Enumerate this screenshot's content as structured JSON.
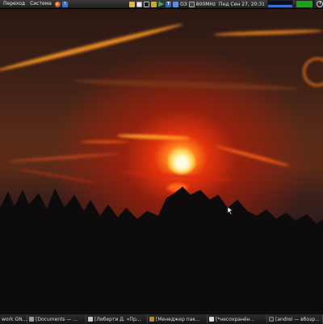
{
  "top_panel": {
    "menus": [
      "Переход",
      "Система"
    ],
    "cpu_frequency": "800MHz",
    "clock": "Пнд Сен 27, 20:31",
    "tray_label": "ОЗ",
    "icons": [
      "firefox-icon",
      "help-icon",
      "folder-icon",
      "notes-icon",
      "monitor-icon",
      "book-icon",
      "media-play-icon",
      "translator-icon",
      "box-icon",
      "chip-icon",
      "power-icon"
    ]
  },
  "taskbar": {
    "tasks": [
      "work GN...",
      "[Documents — ...",
      "[Либерти Д. «Пр...",
      "[Менеджер пак...",
      "[*несохранён...",
      "[andrei — вбозр..."
    ]
  },
  "colors": {
    "panel": "#2a2a2a",
    "sun": "#ffd35c",
    "sky_red": "#e2320c",
    "graph_blue": "#3a6fd0",
    "graph_green": "#1ea01e"
  }
}
